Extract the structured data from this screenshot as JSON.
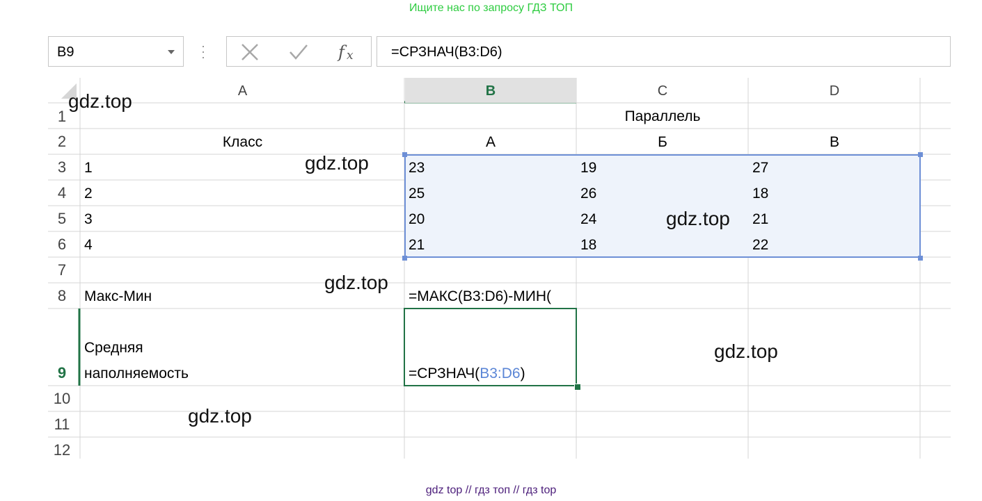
{
  "banners": {
    "top": "Ищите нас по запросу ГДЗ ТОП",
    "bottom": "gdz top  //  гдз топ  //  гдз top"
  },
  "formula_bar": {
    "name_box": "B9",
    "formula": "=СРЗНАЧ(B3:D6)",
    "icons": [
      "cancel-x-icon",
      "enter-check-icon",
      "insert-function-fx-icon"
    ]
  },
  "columns": [
    "A",
    "B",
    "C",
    "D"
  ],
  "active_column": "B",
  "rows": [
    "1",
    "2",
    "3",
    "4",
    "5",
    "6",
    "7",
    "8",
    "9",
    "10",
    "11",
    "12"
  ],
  "active_row": "9",
  "cells": {
    "C1": "Параллель",
    "A2": "Класс",
    "B2": "А",
    "C2": "Б",
    "D2": "В",
    "A3": "1",
    "B3": "23",
    "C3": "19",
    "D3": "27",
    "A4": "2",
    "B4": "25",
    "C4": "26",
    "D4": "18",
    "A5": "3",
    "B5": "20",
    "C5": "24",
    "D5": "21",
    "A6": "4",
    "B6": "21",
    "C6": "18",
    "D6": "22",
    "A8": "Макс-Мин",
    "B8": "=МАКС(B3:D6)-МИН(",
    "A9_line1": "Средняя",
    "A9_line2": "наполняемость",
    "B9_prefix": "=СРЗНАЧ(",
    "B9_ref": "B3:D6",
    "B9_suffix": ")"
  },
  "watermarks": [
    "gdz.top",
    "gdz.top",
    "gdz.top",
    "gdz.top",
    "gdz.top",
    "gdz.top"
  ],
  "colors": {
    "accent_green": "#217346",
    "selection_blue": "#6d8fd6",
    "selection_fill": "#eef3fb",
    "banner_green": "#2ecc40",
    "banner_purple": "#4b1d7a"
  }
}
